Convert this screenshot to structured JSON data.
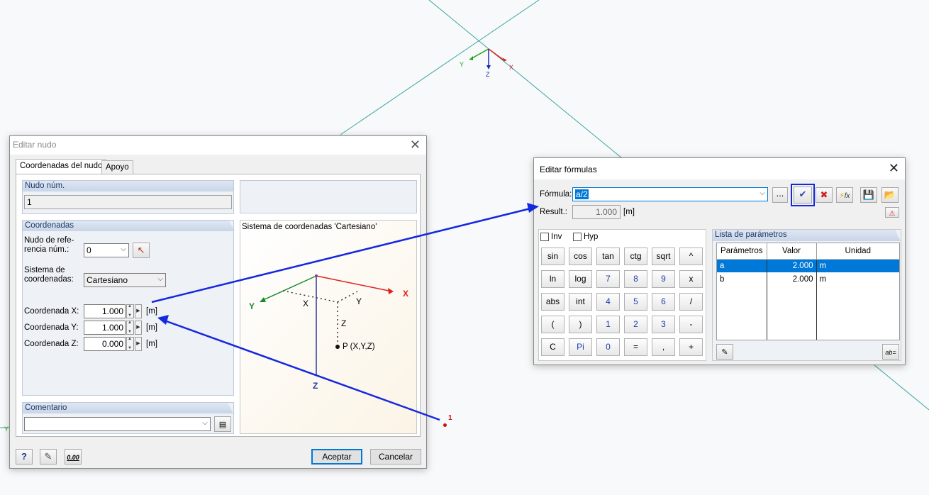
{
  "viewport": {
    "axis_labels": {
      "x": "X",
      "y": "Y",
      "z": "Z"
    },
    "node_marker_label": "1"
  },
  "node_dialog": {
    "title": "Editar nudo",
    "tabs": [
      "Coordenadas del nudo",
      "Apoyo"
    ],
    "node_number": {
      "label": "Nudo núm.",
      "value": "1"
    },
    "coordinates": {
      "group_label": "Coordenadas",
      "ref_node_label": "Nudo de refe-rencia núm.:",
      "ref_node_value": "0",
      "system_label": "Sistema de coordenadas:",
      "system_value": "Cartesiano",
      "x_label": "Coordenada X:",
      "x_value": "1.000",
      "y_label": "Coordenada Y:",
      "y_value": "1.000",
      "z_label": "Coordenada Z:",
      "z_value": "0.000",
      "unit": "[m]"
    },
    "diagram": {
      "title": "Sistema de coordenadas 'Cartesiano'",
      "x": "X",
      "y": "Y",
      "z": "Z",
      "point": "P (X,Y,Z)"
    },
    "comment": {
      "label": "Comentario",
      "value": ""
    },
    "buttons": {
      "accept": "Aceptar",
      "cancel": "Cancelar"
    },
    "footer_icon_text": "0.00"
  },
  "formula_dialog": {
    "title": "Editar fórmulas",
    "formula_label": "Fórmula:",
    "formula_value": "a/2",
    "more_button": "...",
    "result_label": "Result.:",
    "result_value": "1.000",
    "result_unit": "[m]",
    "fx_label": "fx",
    "inv_label": "Inv",
    "hyp_label": "Hyp",
    "keypad": [
      [
        "sin",
        "cos",
        "tan",
        "ctg",
        "sqrt",
        "^"
      ],
      [
        "ln",
        "log",
        "7",
        "8",
        "9",
        "x"
      ],
      [
        "abs",
        "int",
        "4",
        "5",
        "6",
        "/"
      ],
      [
        "(",
        ")",
        "1",
        "2",
        "3",
        "-"
      ],
      [
        "C",
        "Pi",
        "0",
        "=",
        ",",
        "+"
      ]
    ],
    "param_list": {
      "title": "Lista de parámetros",
      "columns": [
        "Parámetros",
        "Valor",
        "Unidad"
      ],
      "rows": [
        {
          "name": "a",
          "value": "2.000",
          "unit": "m"
        },
        {
          "name": "b",
          "value": "2.000",
          "unit": "m"
        }
      ]
    },
    "ab_icon_text": "ab="
  },
  "colors": {
    "accent": "#0078d7",
    "annotation_arrow": "#1428e0",
    "axis_x": "#e02020",
    "axis_y": "#1aa01a",
    "axis_z": "#1a2ab0",
    "model_lines": "#2a9a9a"
  }
}
